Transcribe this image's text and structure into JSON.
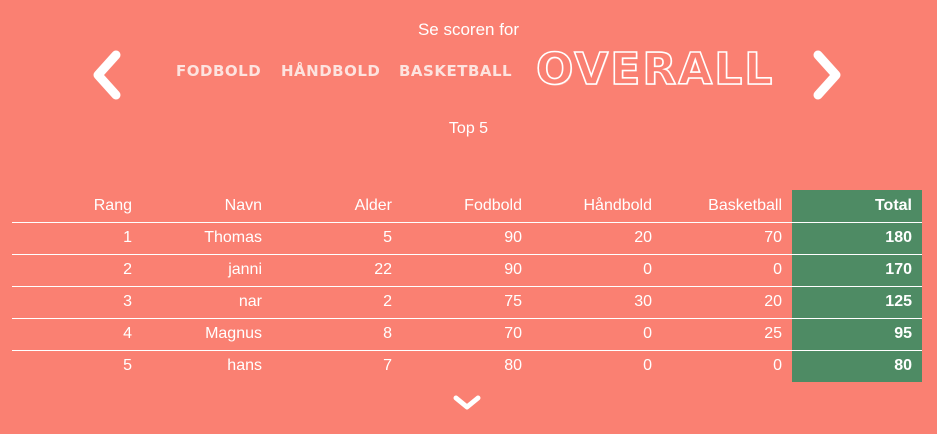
{
  "header": {
    "title": "Se scoren for"
  },
  "navigation": {
    "prev_icon": "chevron-left-icon",
    "next_icon": "chevron-right-icon",
    "tabs": [
      {
        "label": "FODBOLD",
        "active": false
      },
      {
        "label": "HÅNDBOLD",
        "active": false
      },
      {
        "label": "BASKETBALL",
        "active": false
      },
      {
        "label": "OVERALL",
        "active": true
      }
    ]
  },
  "subtitle": "Top 5",
  "table": {
    "columns": [
      "Rang",
      "Navn",
      "Alder",
      "Fodbold",
      "Håndbold",
      "Basketball",
      "Total"
    ],
    "rows": [
      [
        "1",
        "Thomas",
        "5",
        "90",
        "20",
        "70",
        "180"
      ],
      [
        "2",
        "janni",
        "22",
        "90",
        "0",
        "0",
        "170"
      ],
      [
        "3",
        "nar",
        "2",
        "75",
        "30",
        "20",
        "125"
      ],
      [
        "4",
        "Magnus",
        "8",
        "70",
        "0",
        "25",
        "95"
      ],
      [
        "5",
        "hans",
        "7",
        "80",
        "0",
        "0",
        "80"
      ]
    ]
  },
  "scroll_icon": "chevron-down-icon",
  "colors": {
    "background": "#fa8072",
    "total_column": "#4e8b64",
    "text": "#ffffff"
  }
}
